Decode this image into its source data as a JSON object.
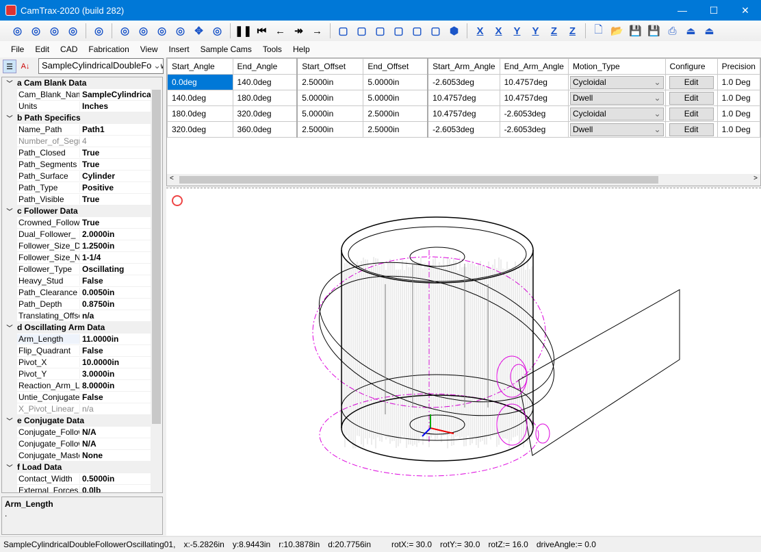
{
  "window": {
    "title": "CamTrax-2020  (build 282)"
  },
  "toolbar": {
    "icons": [
      "add-cylinder-icon",
      "add-box-icon",
      "add-disc-icon",
      "add-profile-icon",
      "import-icon",
      "fit-view-icon",
      "zoom-window-icon",
      "zoom-icon",
      "rotate-icon",
      "pan-icon",
      "orbit-icon",
      "pause-icon",
      "first-icon",
      "step-back-icon",
      "fast-forward-icon",
      "step-forward-icon",
      "view-iso1-icon",
      "view-iso2-icon",
      "view-iso3-icon",
      "view-iso4-icon",
      "view-iso5-icon",
      "view-iso6-icon",
      "view-solid-icon"
    ],
    "axis_buttons": [
      "X",
      "X",
      "Y",
      "Y",
      "Z",
      "Z"
    ],
    "file_icons": [
      "new-icon",
      "open-icon",
      "save-icon",
      "save-all-icon",
      "print-icon",
      "export-icon",
      "export-e-icon"
    ]
  },
  "menu": [
    "File",
    "Edit",
    "CAD",
    "Fabrication",
    "View",
    "Insert",
    "Sample Cams",
    "Tools",
    "Help"
  ],
  "property_grid": {
    "selector": "SampleCylindricalDoubleFollowerOscillating01",
    "rows": [
      {
        "cat": "a Cam Blank Data"
      },
      {
        "k": "Cam_Blank_Name",
        "v": "SampleCylindricalDoubleFollowerOscillating01"
      },
      {
        "k": "Units",
        "v": "Inches"
      },
      {
        "cat": "b Path Specifics"
      },
      {
        "k": "Name_Path",
        "v": "Path1"
      },
      {
        "k": "Number_of_Segments",
        "v": "4",
        "dis": true
      },
      {
        "k": "Path_Closed",
        "v": "True"
      },
      {
        "k": "Path_Segments",
        "v": "True"
      },
      {
        "k": "Path_Surface",
        "v": "Cylinder"
      },
      {
        "k": "Path_Type",
        "v": "Positive"
      },
      {
        "k": "Path_Visible",
        "v": "True"
      },
      {
        "cat": "c Follower Data"
      },
      {
        "k": "Crowned_Follower",
        "v": "True"
      },
      {
        "k": "Dual_Follower_",
        "v": "2.0000in"
      },
      {
        "k": "Follower_Size_D",
        "v": "1.2500in"
      },
      {
        "k": "Follower_Size_N",
        "v": "1-1/4"
      },
      {
        "k": "Follower_Type",
        "v": "Oscillating"
      },
      {
        "k": "Heavy_Stud",
        "v": "False"
      },
      {
        "k": "Path_Clearance",
        "v": "0.0050in"
      },
      {
        "k": "Path_Depth",
        "v": "0.8750in"
      },
      {
        "k": "Translating_Offset",
        "v": "n/a"
      },
      {
        "cat": "d Oscillating Arm Data"
      },
      {
        "k": "Arm_Length",
        "v": "11.0000in"
      },
      {
        "k": "Flip_Quadrant",
        "v": "False"
      },
      {
        "k": "Pivot_X",
        "v": "10.0000in"
      },
      {
        "k": "Pivot_Y",
        "v": "3.0000in"
      },
      {
        "k": "Reaction_Arm_L",
        "v": "8.0000in"
      },
      {
        "k": "Untie_Conjugate",
        "v": "False"
      },
      {
        "k": "X_Pivot_Linear_",
        "v": "n/a",
        "dis": true
      },
      {
        "cat": "e Conjugate Data"
      },
      {
        "k": "Conjugate_Follower",
        "v": "N/A"
      },
      {
        "k": "Conjugate_Follower",
        "v": "N/A"
      },
      {
        "k": "Conjugate_Master",
        "v": "None"
      },
      {
        "cat": "f Load Data"
      },
      {
        "k": "Contact_Width",
        "v": "0.5000in"
      },
      {
        "k": "External_Forces",
        "v": "0.0lb"
      }
    ],
    "description": {
      "title": "Arm_Length",
      "text": "."
    }
  },
  "segments_table": {
    "columns": [
      "Start_Angle",
      "End_Angle",
      "Start_Offset",
      "End_Offset",
      "Start_Arm_Angle",
      "End_Arm_Angle",
      "Motion_Type",
      "Configure",
      "Precision"
    ],
    "rows": [
      [
        "0.0deg",
        "140.0deg",
        "2.5000in",
        "5.0000in",
        "-2.6053deg",
        "10.4757deg",
        "Cycloidal",
        "Edit",
        "1.0 Deg"
      ],
      [
        "140.0deg",
        "180.0deg",
        "5.0000in",
        "5.0000in",
        "10.4757deg",
        "10.4757deg",
        "Dwell",
        "Edit",
        "1.0 Deg"
      ],
      [
        "180.0deg",
        "320.0deg",
        "5.0000in",
        "2.5000in",
        "10.4757deg",
        "-2.6053deg",
        "Cycloidal",
        "Edit",
        "1.0 Deg"
      ],
      [
        "320.0deg",
        "360.0deg",
        "2.5000in",
        "2.5000in",
        "-2.6053deg",
        "-2.6053deg",
        "Dwell",
        "Edit",
        "1.0 Deg"
      ]
    ]
  },
  "status": {
    "name": "SampleCylindricalDoubleFollowerOscillating01,",
    "x": "x:-5.2826in",
    "y": "y:8.9443in",
    "r": "r:10.3878in",
    "d": "d:20.7756in",
    "rotX": "rotX:= 30.0",
    "rotY": "rotY:= 30.0",
    "rotZ": "rotZ:= 16.0",
    "drive": "driveAngle:= 0.0"
  },
  "colors": {
    "titlebar": "#0078d7",
    "selection": "#0078d7",
    "path": "#dd00dd"
  }
}
